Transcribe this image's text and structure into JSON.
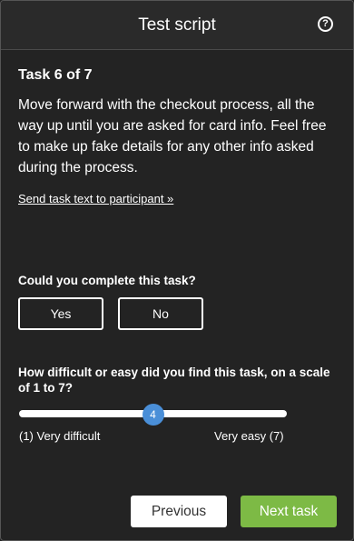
{
  "header": {
    "title": "Test script",
    "help_icon": "question-circle-icon",
    "help_glyph": "?"
  },
  "task": {
    "title": "Task 6 of 7",
    "text": "Move forward with the checkout process, all the way up until you are asked for card info. Feel free to make up fake details for any other info asked during the process.",
    "send_link": "Send task text to participant »"
  },
  "completion": {
    "question": "Could you complete this task?",
    "yes_label": "Yes",
    "no_label": "No"
  },
  "difficulty": {
    "question": "How difficult or easy did you find this task, on a scale of 1 to 7?",
    "min": 1,
    "max": 7,
    "value": 4,
    "value_label": "4",
    "min_label": "(1) Very difficult",
    "max_label": "Very easy (7)"
  },
  "footer": {
    "previous_label": "Previous",
    "next_label": "Next task"
  },
  "colors": {
    "background": "#232323",
    "accent_green": "#7dba45",
    "slider_thumb": "#4a8fd8"
  }
}
